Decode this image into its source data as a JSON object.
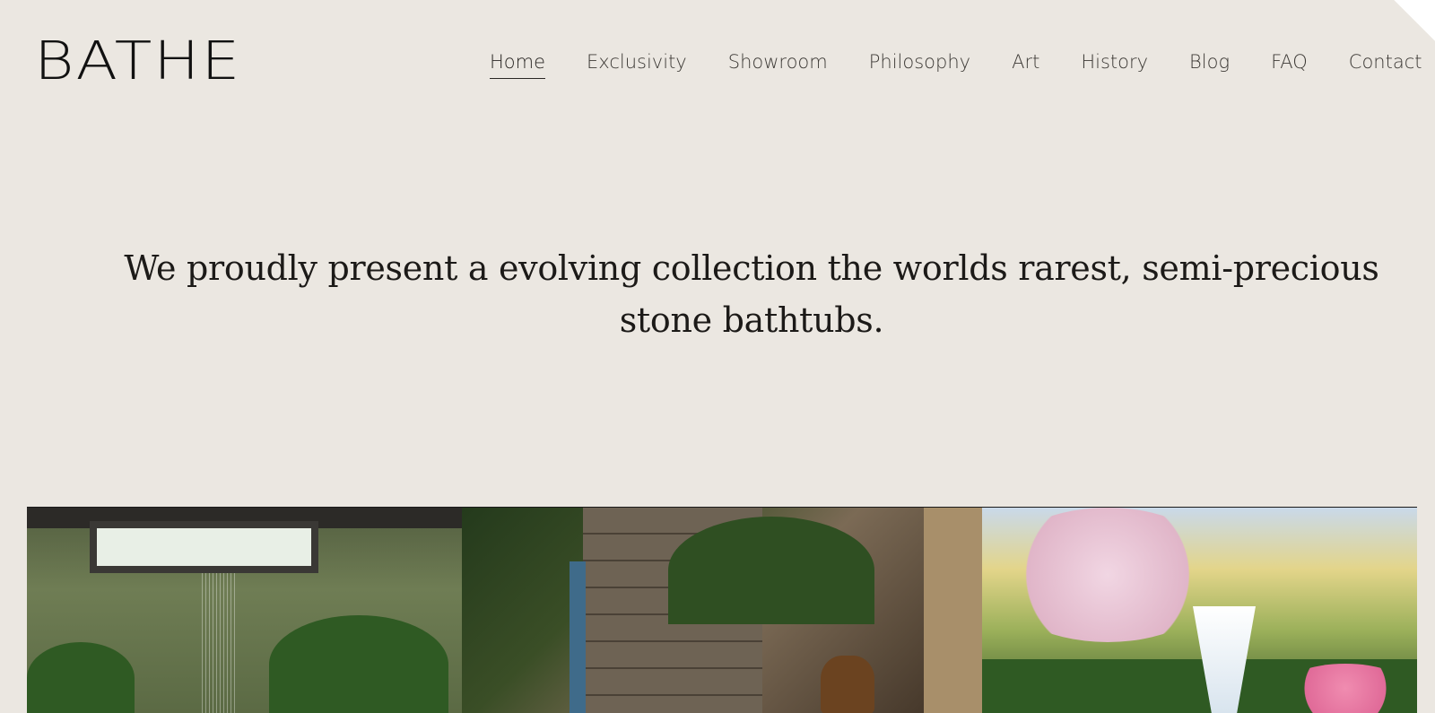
{
  "brand": {
    "logo_text": "BATHE"
  },
  "nav": {
    "items": [
      {
        "label": "Home",
        "active": true
      },
      {
        "label": "Exclusivity"
      },
      {
        "label": "Showroom"
      },
      {
        "label": "Philosophy"
      },
      {
        "label": "Art"
      },
      {
        "label": "History"
      },
      {
        "label": "Blog"
      },
      {
        "label": "FAQ"
      },
      {
        "label": "Contact"
      }
    ]
  },
  "hero": {
    "text": "We proudly present a evolving collection the worlds rarest, semi-precious stone bathtubs."
  },
  "gallery": {
    "images": [
      {
        "name": "rainfall-shower-skylight-image"
      },
      {
        "name": "stone-waterfall-palms-image"
      },
      {
        "name": "garden-fountain-blossoms-image"
      }
    ]
  },
  "colors": {
    "background": "#ebe7e1",
    "text": "#1c1a18",
    "nav_text": "#3c3935"
  }
}
